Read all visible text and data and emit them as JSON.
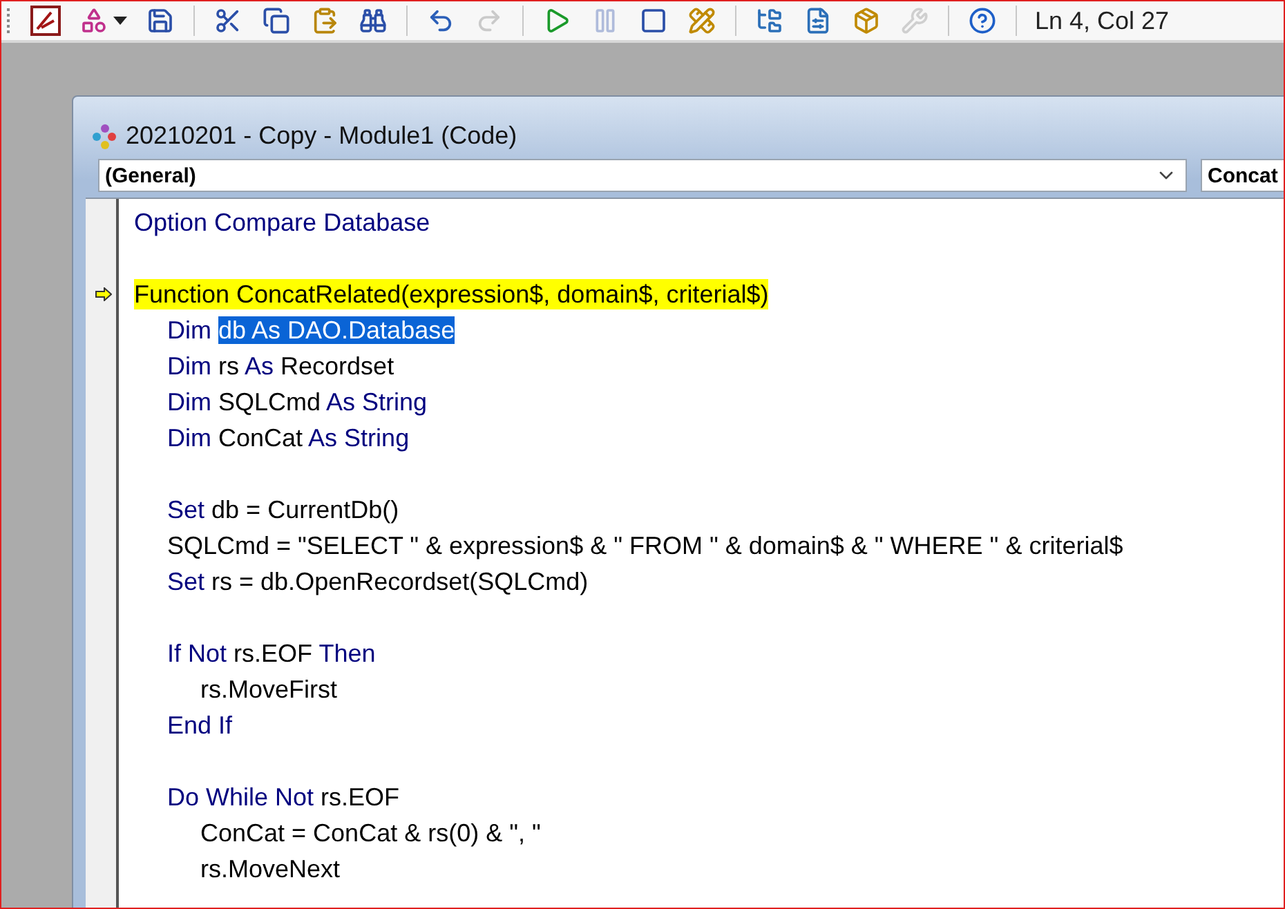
{
  "toolbar": {
    "items": [
      {
        "kind": "app",
        "disabled": false
      },
      {
        "kind": "insert",
        "disabled": false
      },
      {
        "kind": "caret",
        "disabled": false
      },
      {
        "kind": "save",
        "disabled": false
      },
      {
        "kind": "separator"
      },
      {
        "kind": "cut",
        "disabled": false
      },
      {
        "kind": "copy",
        "disabled": false
      },
      {
        "kind": "paste",
        "disabled": false
      },
      {
        "kind": "find",
        "disabled": false
      },
      {
        "kind": "separator"
      },
      {
        "kind": "undo",
        "disabled": false
      },
      {
        "kind": "redo",
        "disabled": true
      },
      {
        "kind": "separator"
      },
      {
        "kind": "run",
        "disabled": false
      },
      {
        "kind": "pause",
        "disabled": true
      },
      {
        "kind": "stop",
        "disabled": false
      },
      {
        "kind": "design",
        "disabled": false
      },
      {
        "kind": "separator"
      },
      {
        "kind": "project",
        "disabled": false
      },
      {
        "kind": "properties",
        "disabled": false
      },
      {
        "kind": "browser",
        "disabled": false
      },
      {
        "kind": "toolbox",
        "disabled": true
      },
      {
        "kind": "separator"
      },
      {
        "kind": "help",
        "disabled": false
      },
      {
        "kind": "separator"
      }
    ],
    "position": "Ln 4, Col 27"
  },
  "window": {
    "title": "20210201 - Copy - Module1 (Code)",
    "object_combo": "(General)",
    "procedure_combo": "Concat",
    "code": [
      {
        "kind": "code",
        "current": false,
        "segments": [
          {
            "kind": "keyword",
            "text": "Option Compare Database"
          }
        ]
      },
      {
        "kind": "blank"
      },
      {
        "kind": "code",
        "current": true,
        "segments": [
          {
            "kind": "text",
            "text": "Function ConcatRelated(expression$, domain$, criterial$)"
          }
        ],
        "children": [
          {
            "kind": "code",
            "current": false,
            "segments": [
              {
                "kind": "keyword",
                "text": "Dim "
              },
              {
                "kind": "selected",
                "text": "db As DAO.Database"
              }
            ]
          },
          {
            "kind": "code",
            "current": false,
            "segments": [
              {
                "kind": "keyword",
                "text": "Dim"
              },
              {
                "kind": "text",
                "text": " rs "
              },
              {
                "kind": "keyword",
                "text": "As"
              },
              {
                "kind": "text",
                "text": " Recordset"
              }
            ]
          },
          {
            "kind": "code",
            "current": false,
            "segments": [
              {
                "kind": "keyword",
                "text": "Dim"
              },
              {
                "kind": "text",
                "text": " SQLCmd "
              },
              {
                "kind": "keyword",
                "text": "As String"
              }
            ]
          },
          {
            "kind": "code",
            "current": false,
            "segments": [
              {
                "kind": "keyword",
                "text": "Dim"
              },
              {
                "kind": "text",
                "text": " ConCat "
              },
              {
                "kind": "keyword",
                "text": "As String"
              }
            ]
          },
          {
            "kind": "blank"
          },
          {
            "kind": "code",
            "current": false,
            "segments": [
              {
                "kind": "keyword",
                "text": "Set"
              },
              {
                "kind": "text",
                "text": " db = CurrentDb()"
              }
            ]
          },
          {
            "kind": "code",
            "current": false,
            "segments": [
              {
                "kind": "text",
                "text": "SQLCmd = \"SELECT \" & expression$ & \" FROM \" & domain$ & \" WHERE \" & criterial$"
              }
            ]
          },
          {
            "kind": "code",
            "current": false,
            "segments": [
              {
                "kind": "keyword",
                "text": "Set"
              },
              {
                "kind": "text",
                "text": " rs = db.OpenRecordset(SQLCmd)"
              }
            ]
          },
          {
            "kind": "blank"
          },
          {
            "kind": "code",
            "current": false,
            "segments": [
              {
                "kind": "keyword",
                "text": "If Not"
              },
              {
                "kind": "text",
                "text": " rs.EOF "
              },
              {
                "kind": "keyword",
                "text": "Then"
              }
            ],
            "children": [
              {
                "kind": "code",
                "current": false,
                "segments": [
                  {
                    "kind": "text",
                    "text": "rs.MoveFirst"
                  }
                ]
              }
            ]
          },
          {
            "kind": "code",
            "current": false,
            "segments": [
              {
                "kind": "keyword",
                "text": "End If"
              }
            ]
          },
          {
            "kind": "blank"
          },
          {
            "kind": "code",
            "current": false,
            "segments": [
              {
                "kind": "keyword",
                "text": "Do While Not"
              },
              {
                "kind": "text",
                "text": " rs.EOF"
              }
            ],
            "children": [
              {
                "kind": "code",
                "current": false,
                "segments": [
                  {
                    "kind": "text",
                    "text": "ConCat = ConCat & rs(0) & \", \""
                  }
                ]
              },
              {
                "kind": "code",
                "current": false,
                "segments": [
                  {
                    "kind": "text",
                    "text": "rs.MoveNext"
                  }
                ]
              }
            ]
          }
        ]
      }
    ]
  }
}
